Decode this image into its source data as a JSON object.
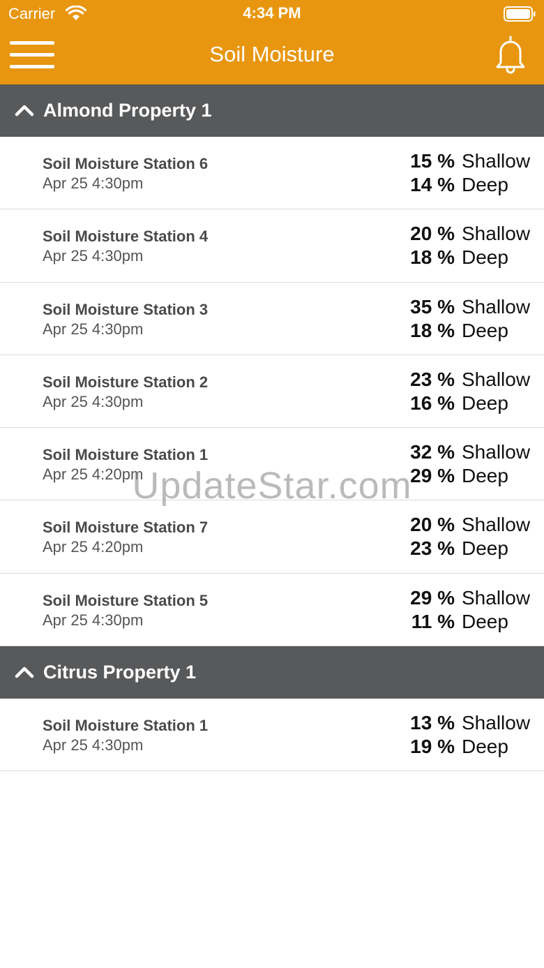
{
  "status_bar": {
    "carrier": "Carrier",
    "time": "4:34 PM"
  },
  "nav": {
    "title": "Soil Moisture",
    "menu_icon": "hamburger-menu-icon",
    "bell_icon": "bell-icon"
  },
  "theme": {
    "header_color": "#E8960F",
    "section_color": "#58595B"
  },
  "sections": [
    {
      "title": "Almond Property 1",
      "stations": [
        {
          "name": "Soil Moisture Station 6",
          "time": "Apr 25 4:30pm",
          "shallow": "15 %",
          "deep": "14 %"
        },
        {
          "name": "Soil Moisture Station 4",
          "time": "Apr 25 4:30pm",
          "shallow": "20 %",
          "deep": "18 %"
        },
        {
          "name": "Soil Moisture Station 3",
          "time": "Apr 25 4:30pm",
          "shallow": "35 %",
          "deep": "18 %"
        },
        {
          "name": "Soil Moisture Station 2",
          "time": "Apr 25 4:30pm",
          "shallow": "23 %",
          "deep": "16 %"
        },
        {
          "name": "Soil Moisture Station 1",
          "time": "Apr 25 4:20pm",
          "shallow": "32 %",
          "deep": "29 %"
        },
        {
          "name": "Soil Moisture Station 7",
          "time": "Apr 25 4:20pm",
          "shallow": "20 %",
          "deep": "23 %"
        },
        {
          "name": "Soil Moisture Station 5",
          "time": "Apr 25 4:30pm",
          "shallow": "29 %",
          "deep": "11 %"
        }
      ]
    },
    {
      "title": "Citrus Property 1",
      "stations": [
        {
          "name": "Soil Moisture Station 1",
          "time": "Apr 25 4:30pm",
          "shallow": "13 %",
          "deep": "19 %"
        }
      ]
    }
  ],
  "labels": {
    "shallow": "Shallow",
    "deep": "Deep"
  },
  "watermark": "UpdateStar.com"
}
